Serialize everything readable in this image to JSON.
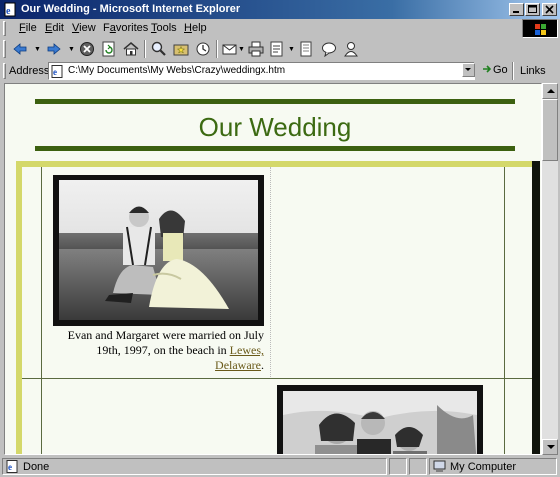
{
  "window": {
    "title": "Our Wedding - Microsoft Internet Explorer"
  },
  "menu": {
    "items": [
      {
        "label": "File",
        "accel": "F"
      },
      {
        "label": "Edit",
        "accel": "E"
      },
      {
        "label": "View",
        "accel": "V"
      },
      {
        "label": "Favorites",
        "accel": "a"
      },
      {
        "label": "Tools",
        "accel": "T"
      },
      {
        "label": "Help",
        "accel": "H"
      }
    ]
  },
  "toolbar": {
    "buttons": [
      "back-icon",
      "forward-icon",
      "stop-icon",
      "refresh-icon",
      "home-icon",
      "search-icon",
      "favorites-icon",
      "history-icon",
      "mail-icon",
      "print-icon",
      "edit-icon",
      "discuss-icon",
      "messenger-icon"
    ]
  },
  "address": {
    "label": "Address",
    "value": "C:\\My Documents\\My Webs\\Crazy\\weddingx.htm",
    "go_label": "Go",
    "links_label": "Links"
  },
  "page": {
    "heading": "Our Wedding",
    "caption_text": "Evan and Margaret were married on July 19th, 1997, on the beach in",
    "caption_link": "Lewes, Delaware",
    "caption_end": ".",
    "colors": {
      "heading": "#3c6a12",
      "rule": "#3c6010",
      "frame_light": "#d4d86a",
      "frame_dark": "#10140c",
      "background": "#f7faf2",
      "link": "#6a5a1a"
    }
  },
  "status": {
    "left_text": "Done",
    "zone_text": "My Computer"
  }
}
